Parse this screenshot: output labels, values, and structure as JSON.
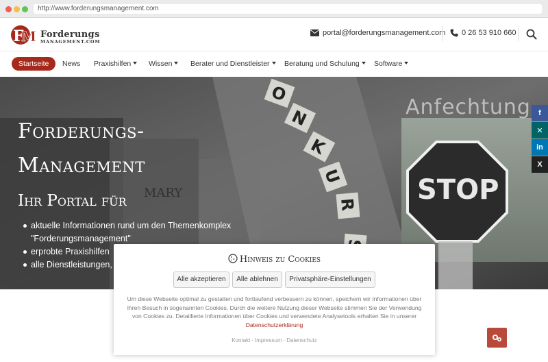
{
  "browser": {
    "url": "http://www.forderungsmanagement.com"
  },
  "header": {
    "logo_mark": "FM",
    "logo_line1": "Forderungs",
    "logo_line2": "MANAGEMENT.COM",
    "email": "portal@forderungsmanagement.com",
    "phone": "0 26 53 910 660"
  },
  "nav": {
    "items": [
      {
        "label": "Startseite",
        "dropdown": false
      },
      {
        "label": "News",
        "dropdown": false
      },
      {
        "label": "Praxishilfen",
        "dropdown": true
      },
      {
        "label": "Wissen",
        "dropdown": true
      },
      {
        "label": "Berater und Dienstleister",
        "dropdown": true
      },
      {
        "label": "Beratung und Schulung",
        "dropdown": true
      },
      {
        "label": "Software",
        "dropdown": true
      }
    ]
  },
  "hero": {
    "title_line1": "Forderungs-",
    "title_line2": "Management",
    "subtitle": "Ihr Portal für",
    "bullets": [
      "aktuelle Informationen rund um den Themenkomplex",
      "\"Forderungsmanagement\"",
      "erprobte Praxishilfen",
      "alle Dienstleistungen,"
    ],
    "image_text_anfechtung": "Anfechtung",
    "image_text_stop": "STOP",
    "image_text_tiles": [
      "O",
      "N",
      "K",
      "U",
      "R",
      "S"
    ],
    "image_text_grave": "MARY"
  },
  "social": {
    "items": [
      {
        "icon": "facebook-icon",
        "glyph": "f",
        "color": "#3b5998"
      },
      {
        "icon": "xing-icon",
        "glyph": "✕",
        "color": "#026466"
      },
      {
        "icon": "linkedin-icon",
        "glyph": "in",
        "color": "#0077b5"
      },
      {
        "icon": "x-twitter-icon",
        "glyph": "X",
        "color": "#222222"
      }
    ]
  },
  "cookie": {
    "title": "Hinweis zu Cookies",
    "accept_all": "Alle akzeptieren",
    "reject_all": "Alle ablehnen",
    "privacy_settings": "Privatsphäre-Einstellungen",
    "text": "Um diese Webseite optimal zu gestalten und fortlaufend verbessern zu können, speichern wir Informationen über Ihren Besuch in sogenannten Cookies. Durch die weitere Nutzung dieser Webseite stimmen Sie der Verwendung von Cookies zu. Detaillierte Informationen über Cookies und verwendete Analysetools erhalten Sie in unserer",
    "privacy_link": "Datenschutzerklärung",
    "footer_links": [
      "Kontakt",
      "Impressum",
      "Datenschutz"
    ]
  },
  "colors": {
    "accent": "#a6291b",
    "cookie_button": "#b94a39"
  }
}
